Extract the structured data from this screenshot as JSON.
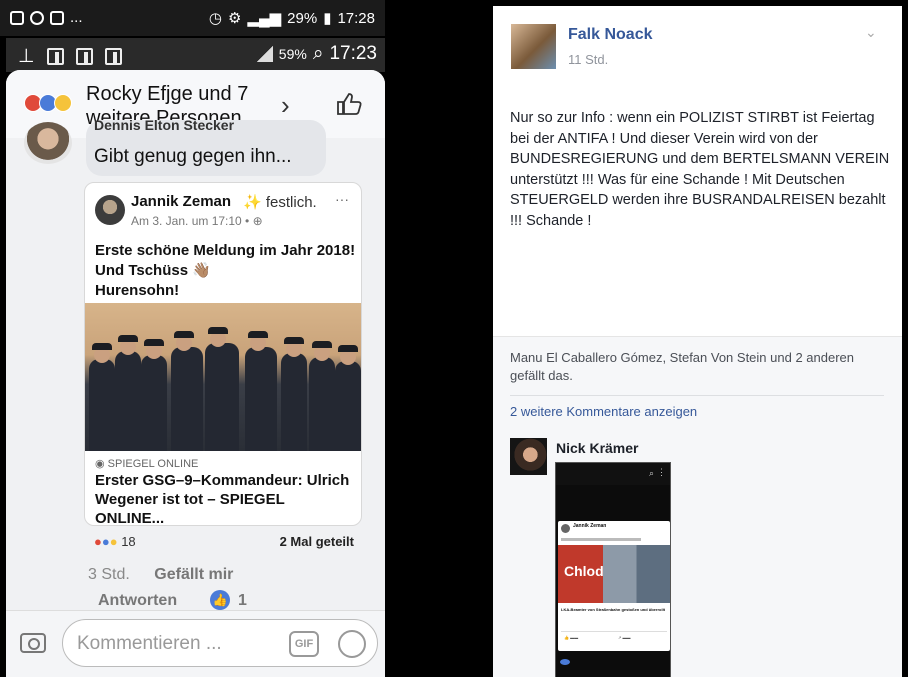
{
  "phone": {
    "status1": {
      "battery": "29%",
      "time": "17:28"
    },
    "status2": {
      "battery": "59%",
      "time": "17:23"
    },
    "sheet": {
      "title": "Rocky Efjge und 7 weitere Personen",
      "chevron": "›"
    },
    "comment": {
      "author": "Dennis Elton Stecker",
      "text": "Gibt genug gegen ihn..."
    },
    "shared_post": {
      "author": "Jannik Zeman",
      "feeling": "festlich.",
      "date": "Am 3. Jan. um 17:10 •",
      "dots": "···",
      "text_lines": [
        "Erste schöne Meldung im Jahr 2018!",
        "Und Tschüss 👋🏽",
        "Hurensohn!"
      ],
      "source": "SPIEGEL ONLINE",
      "headline": "Erster GSG–9–Kommandeur: Ulrich Wegener ist tot – SPIEGEL ONLINE...",
      "reaction_count": "18",
      "shares": "2 Mal geteilt"
    },
    "comment_meta": {
      "time": "3 Std.",
      "like": "Gefällt mir",
      "reply": "Antworten",
      "likes_count": "1"
    },
    "input": {
      "placeholder": "Kommentieren ...",
      "gif": "GIF"
    }
  },
  "post": {
    "author": "Falk Noack",
    "time": "11 Std.",
    "chevron": "⌄",
    "text": "Nur so zur Info : wenn ein POLIZIST STIRBT ist Feiertag bei der ANTIFA ! Und dieser Verein wird von der BUNDESREGIERUNG und dem BERTELSMANN VEREIN unterstützt !!! Was für eine Schande ! Mit Deutschen STEUERGELD werden ihre BUSRANDALREISEN bezahlt !!! Schande !",
    "likes_line": "Manu El Caballero Gómez, Stefan Von Stein und 2 anderen gefällt das.",
    "more_comments": "2 weitere Kommentare anzeigen",
    "commenter": "Nick Krämer",
    "attachment": {
      "mini_author": "Jannik Zeman",
      "photo_text": "Chlod",
      "caption": "LKA-Beamter von Straßenbahn gestoßen und überrollt"
    }
  },
  "colors": {
    "fb_link": "#365899",
    "like_blue": "#4a7bd8",
    "sheet_bg": "#f0f1f3",
    "post_footer_bg": "#f6f7f9"
  }
}
